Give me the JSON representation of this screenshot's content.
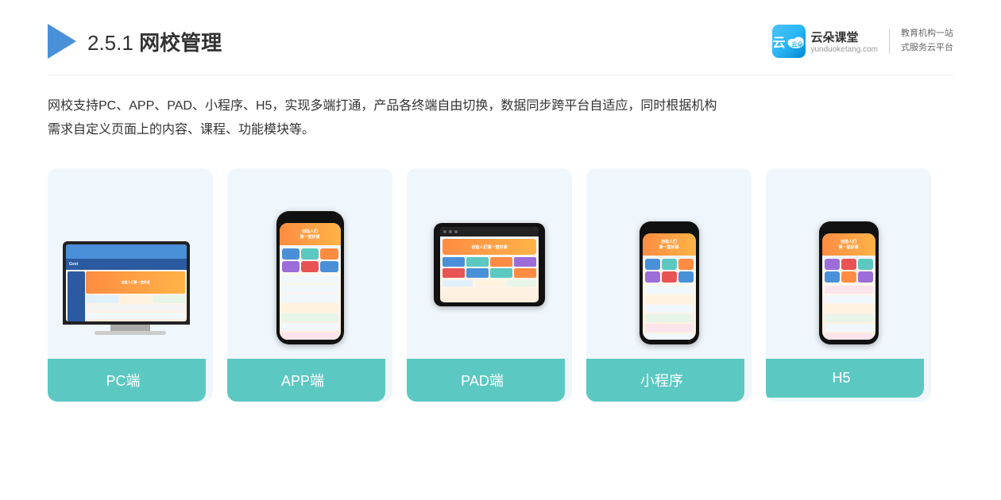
{
  "header": {
    "section_number": "2.5.1",
    "title_normal": "2.5.1 ",
    "title_bold": "网校管理"
  },
  "brand": {
    "icon_char": "云",
    "name": "云朵课堂",
    "url": "yunduoketang.com",
    "divider": "|",
    "slogan_line1": "教育机构一站",
    "slogan_line2": "式服务云平台"
  },
  "description": {
    "text": "网校支持PC、APP、PAD、小程序、H5，实现多端打通，产品各终端自由切换，数据同步跨平台自适应，同时根据机构\n需求自定义页面上的内容、课程、功能模块等。"
  },
  "cards": [
    {
      "id": "pc",
      "label": "PC端"
    },
    {
      "id": "app",
      "label": "APP端"
    },
    {
      "id": "pad",
      "label": "PAD端"
    },
    {
      "id": "mini",
      "label": "小程序"
    },
    {
      "id": "h5",
      "label": "H5"
    }
  ]
}
